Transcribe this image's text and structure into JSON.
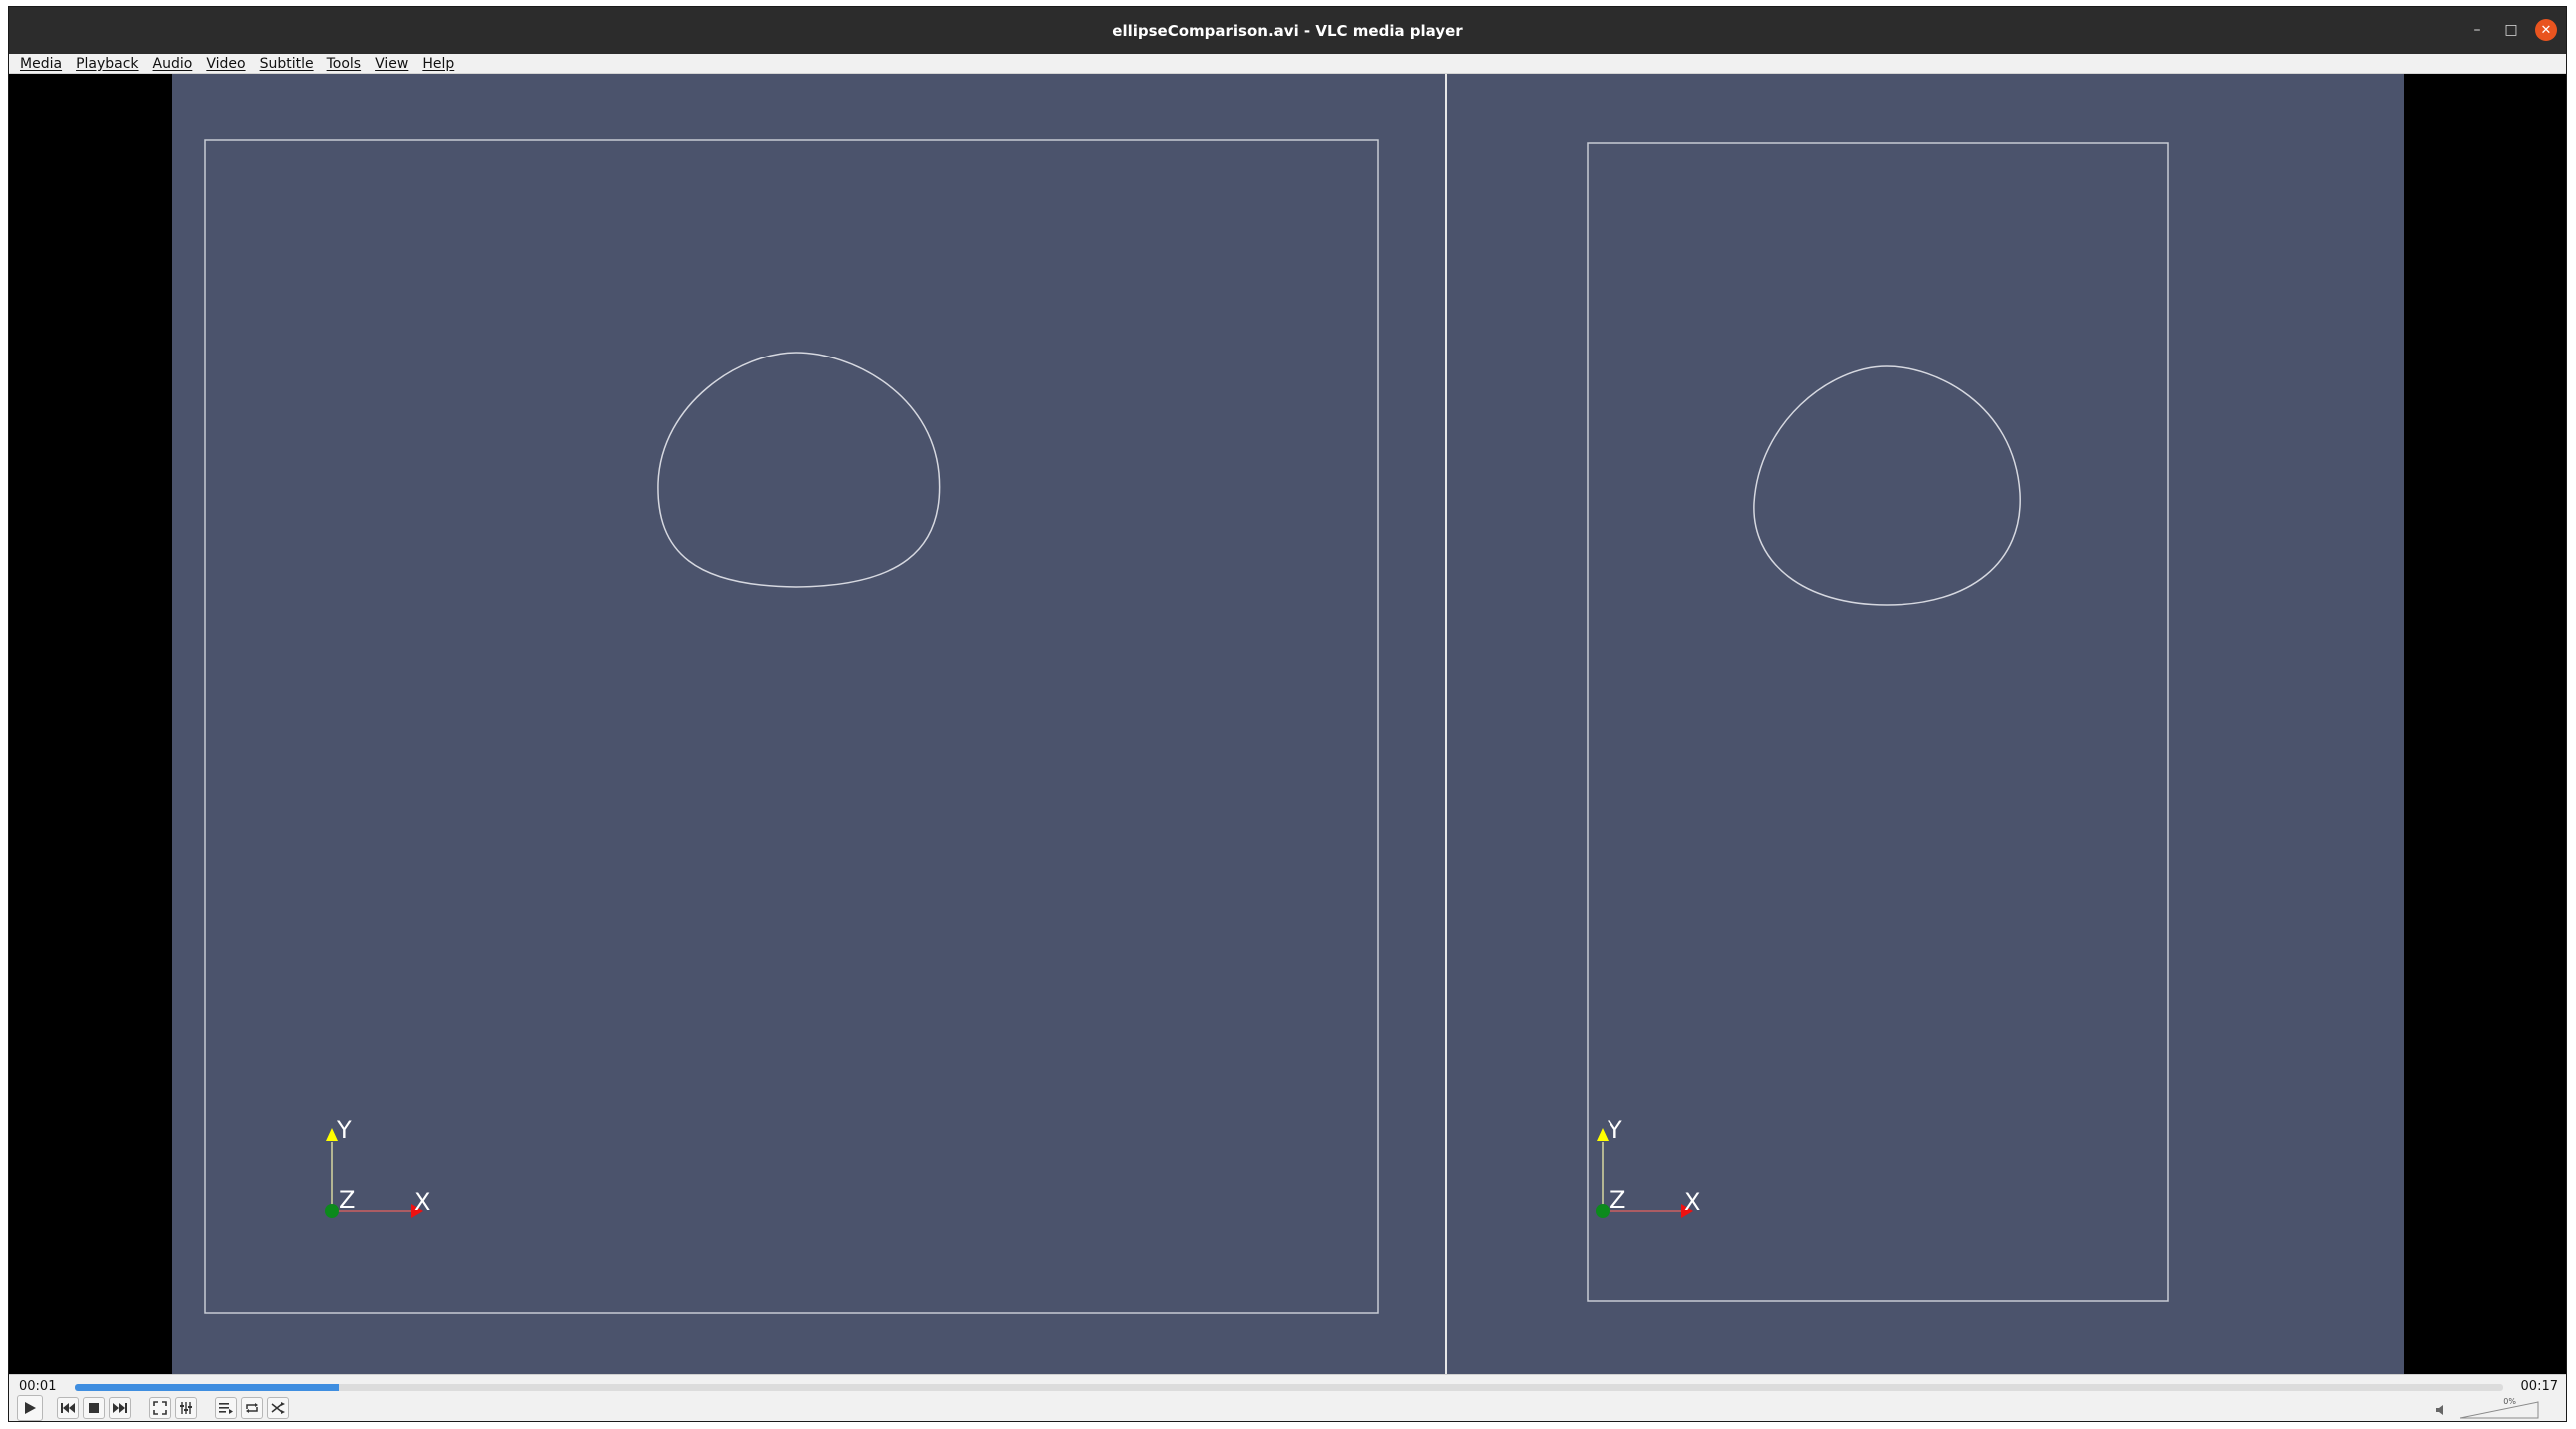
{
  "window": {
    "title": "ellipseComparison.avi - VLC media player"
  },
  "menu": {
    "items": [
      {
        "label": "Media"
      },
      {
        "label": "Playback"
      },
      {
        "label": "Audio"
      },
      {
        "label": "Video"
      },
      {
        "label": "Subtitle"
      },
      {
        "label": "Tools"
      },
      {
        "label": "View"
      },
      {
        "label": "Help"
      }
    ]
  },
  "video": {
    "background_color": "#4b536c",
    "left_panel": {
      "axes": {
        "y": "Y",
        "z": "Z",
        "x": "X"
      }
    },
    "right_panel": {
      "axes": {
        "y": "Y",
        "z": "Z",
        "x": "X"
      }
    }
  },
  "playback": {
    "elapsed": "00:01",
    "total": "00:17",
    "progress_fraction": 0.109,
    "volume_label": "0%"
  },
  "controls": {
    "icons": [
      "play-icon",
      "previous-icon",
      "stop-icon",
      "next-icon",
      "fullscreen-icon",
      "extended-settings-icon",
      "playlist-icon",
      "loop-icon",
      "shuffle-icon"
    ]
  }
}
